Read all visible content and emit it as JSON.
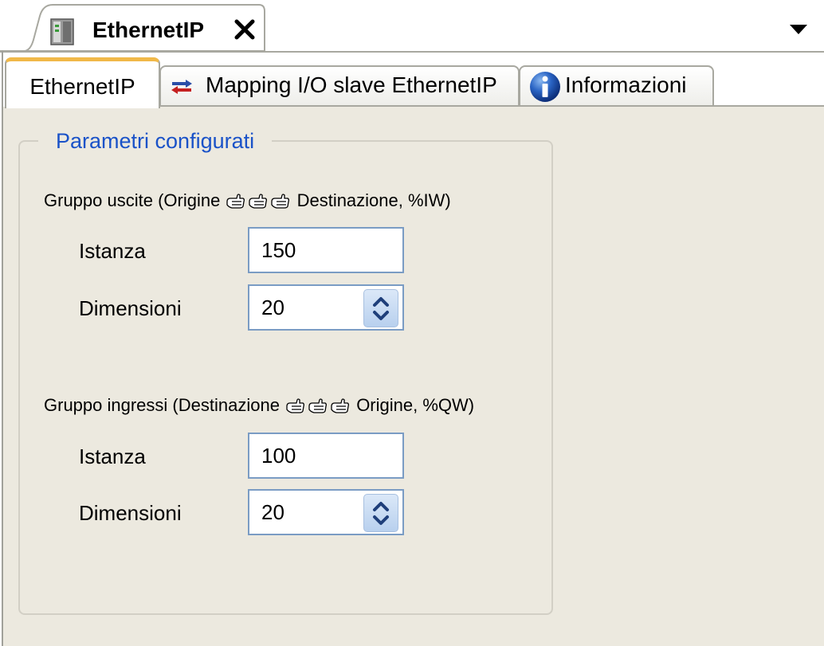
{
  "editor_tab": {
    "title": "EthernetIP",
    "icon": "device-icon",
    "close_icon": "close-icon",
    "menu_icon": "chevron-down-icon"
  },
  "subtabs": [
    {
      "label": "EthernetIP",
      "active": true
    },
    {
      "label": "Mapping I/O slave EthernetIP",
      "icon": "exchange-arrows-icon"
    },
    {
      "label": "Informazioni",
      "icon": "info-icon"
    }
  ],
  "group": {
    "title": "Parametri configurati",
    "outputs": {
      "label_prefix": "Gruppo uscite (Origine",
      "label_suffix": "Destinazione, %IW)",
      "instance_label": "Istanza",
      "instance_value": "150",
      "size_label": "Dimensioni",
      "size_value": "20"
    },
    "inputs": {
      "label_prefix": "Gruppo ingressi (Destinazione",
      "label_suffix": "Origine, %QW)",
      "instance_label": "Istanza",
      "instance_value": "100",
      "size_label": "Dimensioni",
      "size_value": "20"
    }
  },
  "colors": {
    "group_title": "#1a52c8",
    "active_tab_accent": "#f0b848",
    "panel_background": "#ece9df",
    "field_border": "#7a9cc4"
  }
}
